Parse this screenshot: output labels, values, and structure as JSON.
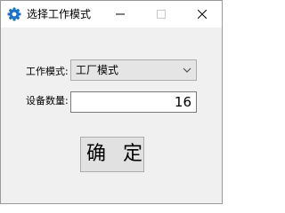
{
  "window": {
    "title": "选择工作模式",
    "icon": "gear-icon",
    "accent": "#1e73c8"
  },
  "form": {
    "mode_label": "工作模式:",
    "mode_value": "工厂模式",
    "count_label": "设备数量:",
    "count_value": "16"
  },
  "buttons": {
    "confirm_label": "确 定"
  }
}
